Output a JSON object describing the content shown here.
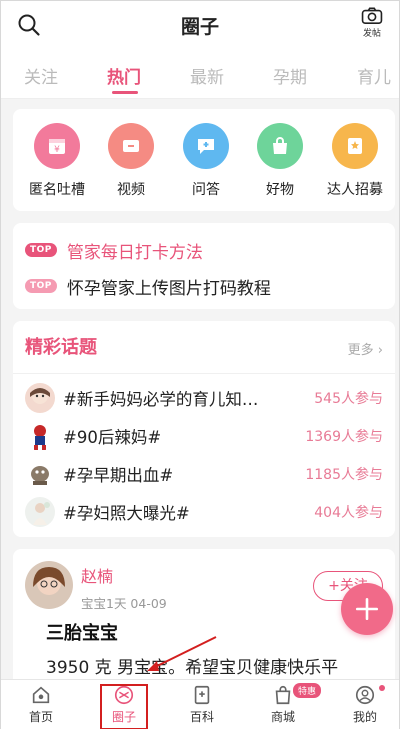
{
  "header": {
    "title": "圈子",
    "search_icon": "search-icon",
    "post_icon": "camera-icon",
    "post_label": "发帖"
  },
  "tabs": [
    {
      "label": "关注",
      "active": false
    },
    {
      "label": "热门",
      "active": true
    },
    {
      "label": "最新",
      "active": false
    },
    {
      "label": "孕期",
      "active": false
    },
    {
      "label": "育儿",
      "active": false
    }
  ],
  "quick_actions": [
    {
      "label": "匿名吐槽",
      "icon": "calendar-icon",
      "color": "#f27a9b"
    },
    {
      "label": "视频",
      "icon": "video-icon",
      "color": "#f58b83"
    },
    {
      "label": "问答",
      "icon": "chat-plus-icon",
      "color": "#5fb8f0"
    },
    {
      "label": "好物",
      "icon": "shopping-bag-icon",
      "color": "#6ed49a"
    },
    {
      "label": "达人招募",
      "icon": "certificate-icon",
      "color": "#f7b64c"
    }
  ],
  "notices": [
    {
      "tag": "TOP",
      "text": "管家每日打卡方法",
      "tag_color": "#e8547a",
      "text_color": "#e8547a"
    },
    {
      "tag": "TOP",
      "text": "怀孕管家上传图片打码教程",
      "tag_color": "#f59bb2",
      "text_color": "#222222"
    }
  ],
  "topics": {
    "title": "精彩话题",
    "more": "更多",
    "items": [
      {
        "title": "#新手妈妈必学的育儿知…",
        "count": "545人参与"
      },
      {
        "title": "#90后辣妈#",
        "count": "1369人参与"
      },
      {
        "title": "#孕早期出血#",
        "count": "1185人参与"
      },
      {
        "title": "#孕妇照大曝光#",
        "count": "404人参与"
      }
    ]
  },
  "post": {
    "author": "赵楠",
    "meta": "宝宝1天    04-09",
    "follow_label": "+关注",
    "title": "三胎宝宝",
    "body": "3950 克 男宝宝。希望宝贝健康快乐平"
  },
  "fab_icon": "plus-icon",
  "bottom_nav": [
    {
      "label": "首页",
      "icon": "home-icon",
      "active": false
    },
    {
      "label": "圈子",
      "icon": "circle-icon",
      "active": true
    },
    {
      "label": "百科",
      "icon": "book-icon",
      "active": false
    },
    {
      "label": "商城",
      "icon": "bag-icon",
      "active": false,
      "badge": "特惠"
    },
    {
      "label": "我的",
      "icon": "user-icon",
      "active": false
    }
  ],
  "colors": {
    "accent": "#e8547a",
    "highlight_box": "#d31f1f"
  }
}
